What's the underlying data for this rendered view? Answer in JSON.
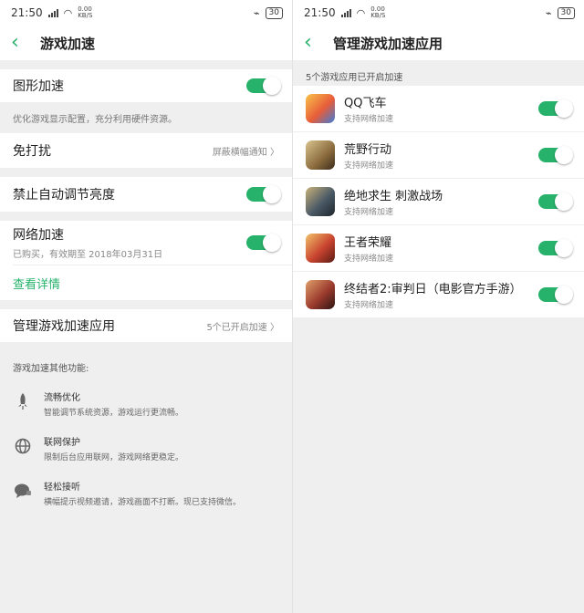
{
  "status": {
    "time": "21:50",
    "net_rate": "0.00\nKB/S",
    "battery": "30"
  },
  "left": {
    "header": {
      "title": "游戏加速"
    },
    "graphics": {
      "label": "图形加速",
      "desc": "优化游戏显示配置，充分利用硬件资源。"
    },
    "dnd": {
      "label": "免打扰",
      "value": "屏蔽横幅通知"
    },
    "brightness": {
      "label": "禁止自动调节亮度"
    },
    "network": {
      "label": "网络加速",
      "sub": "已购买，有效期至 2018年03月31日",
      "detail_link": "查看详情"
    },
    "manage": {
      "label": "管理游戏加速应用",
      "value": "5个已开启加速"
    },
    "features": {
      "title": "游戏加速其他功能:",
      "items": [
        {
          "name": "流畅优化",
          "desc": "智能调节系统资源，游戏运行更流畅。",
          "icon": "rocket-icon"
        },
        {
          "name": "联网保护",
          "desc": "限制后台应用联网，游戏网络更稳定。",
          "icon": "globe-icon"
        },
        {
          "name": "轻松接听",
          "desc": "横幅提示视频邀请，游戏画面不打断。现已支持微信。",
          "icon": "chat-icon"
        }
      ]
    }
  },
  "right": {
    "header": {
      "title": "管理游戏加速应用"
    },
    "note": "5个游戏应用已开启加速",
    "apps": [
      {
        "name": "QQ飞车",
        "status": "支持网络加速",
        "color": "#e85d3a"
      },
      {
        "name": "荒野行动",
        "status": "支持网络加速",
        "color": "#8a6a3c"
      },
      {
        "name": "绝地求生 刺激战场",
        "status": "支持网络加速",
        "color": "#4a5a66"
      },
      {
        "name": "王者荣耀",
        "status": "支持网络加速",
        "color": "#c8432f"
      },
      {
        "name": "终结者2:审判日（电影官方手游）",
        "status": "支持网络加速",
        "color": "#9b3a2e"
      }
    ]
  },
  "accent": "#27b26b"
}
